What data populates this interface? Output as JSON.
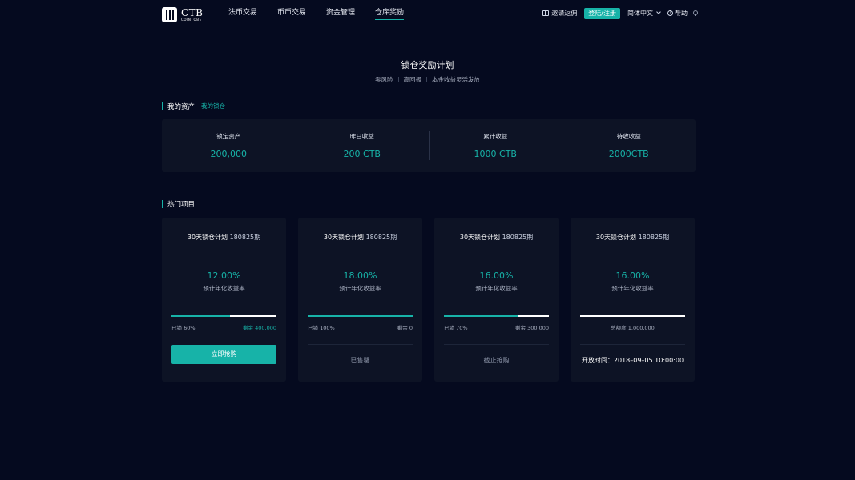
{
  "header": {
    "logo": {
      "title": "CTB",
      "subtitle": "COINTOBE"
    },
    "nav": [
      {
        "label": "法币交易"
      },
      {
        "label": "币币交易"
      },
      {
        "label": "资金管理"
      },
      {
        "label": "仓库奖励",
        "active": true
      }
    ],
    "invite_label": "邀请返佣",
    "login_label": "登陆/注册",
    "language_label": "简体中文",
    "help_label": "帮助"
  },
  "hero": {
    "title": "锁仓奖励计划",
    "tags": [
      "零风险",
      "高回报",
      "本金收益灵活发放"
    ]
  },
  "assets_section": {
    "title": "我的资产",
    "link_label": "我的锁仓",
    "items": [
      {
        "label": "锁定资产",
        "value": "200,000"
      },
      {
        "label": "昨日收益",
        "value": "200 CTB"
      },
      {
        "label": "累计收益",
        "value": "1000 CTB"
      },
      {
        "label": "待收收益",
        "value": "2000CTB"
      }
    ]
  },
  "projects_section": {
    "title": "热门项目",
    "cards": [
      {
        "title": "30天锁仓计划",
        "period": "180825期",
        "rate": "12.00%",
        "rate_label": "预计年化收益率",
        "progress": 0.56,
        "sold_label": "已锁 60%",
        "remaining_label": "剩余 400,000",
        "action": "立即抢购"
      },
      {
        "title": "30天锁仓计划",
        "period": "180825期",
        "rate": "18.00%",
        "rate_label": "预计年化收益率",
        "progress": 1.0,
        "sold_label": "已锁 100%",
        "remaining_label": "剩余 0",
        "status": "已售罄"
      },
      {
        "title": "30天锁仓计划",
        "period": "180825期",
        "rate": "16.00%",
        "rate_label": "预计年化收益率",
        "progress": 0.7,
        "sold_label": "已锁 70%",
        "remaining_label": "剩余 300,000",
        "status": "截止抢购"
      },
      {
        "title": "30天锁仓计划",
        "period": "180825期",
        "rate": "16.00%",
        "rate_label": "预计年化收益率",
        "progress": 0,
        "total_label": "总额度 1,000,000",
        "open_time": "开放时间：2018–09–05 10:00:00"
      }
    ]
  },
  "colors": {
    "accent": "#17b3a8",
    "background": "#050a1f",
    "card": "#0d1325"
  }
}
